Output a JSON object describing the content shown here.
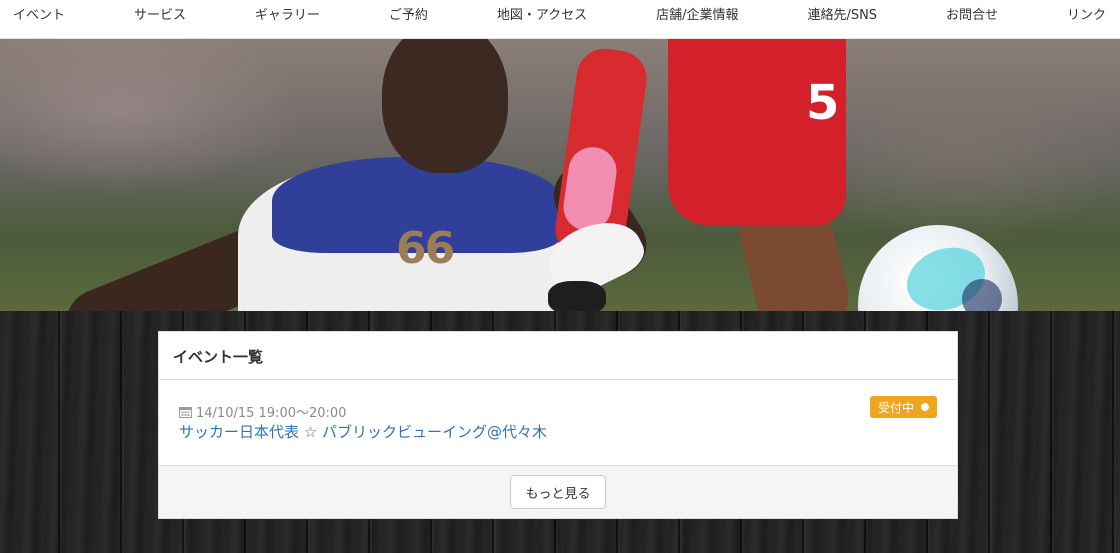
{
  "nav": {
    "items": [
      {
        "label": "イベント"
      },
      {
        "label": "サービス"
      },
      {
        "label": "ギャラリー"
      },
      {
        "label": "ご予約"
      },
      {
        "label": "地図・アクセス"
      },
      {
        "label": "店舗/企業情報"
      },
      {
        "label": "連絡先/SNS"
      },
      {
        "label": "お問合せ"
      },
      {
        "label": "リンク"
      }
    ]
  },
  "hero": {
    "blue_shirt_number": "66",
    "red_shirt_number": "5",
    "colors": {
      "blue_kit": "#2f3f9a",
      "red_kit": "#d4202a",
      "grass": "#4c5a3c"
    }
  },
  "events_panel": {
    "heading": "イベント一覧",
    "events": [
      {
        "date": "14/10/15 19:00〜20:00",
        "title": "サッカー日本代表 ☆ パブリックビューイング@代々木",
        "status": "受付中"
      }
    ],
    "more_button": "もっと見る"
  },
  "colors": {
    "link": "#3173b5",
    "badge": "#f0a51e",
    "nav_bg": "#ffffff",
    "wood_bg": "#1f1f1f"
  },
  "icons": {
    "date": "calendar-icon",
    "status_dot": "dot-icon"
  }
}
